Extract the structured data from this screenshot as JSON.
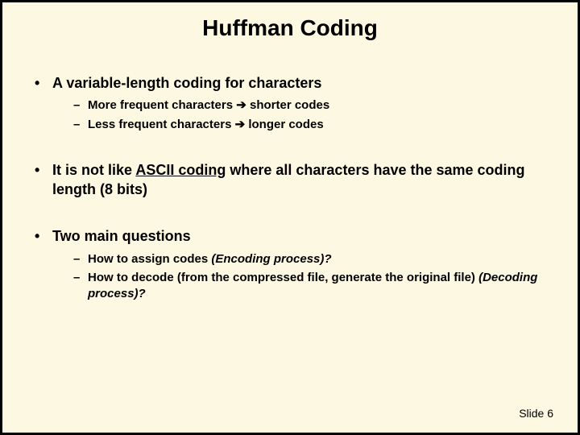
{
  "title": "Huffman Coding",
  "bullets": {
    "b1": {
      "text": "A variable-length coding for characters",
      "sub": {
        "s1a": "More frequent characters ",
        "s1arrow": "➔",
        "s1b": " shorter codes",
        "s2a": "Less frequent characters ",
        "s2arrow": "➔",
        "s2b": " longer codes"
      }
    },
    "b2": {
      "prefix": "It is not like ",
      "underlined": "ASCII coding",
      "suffix": " where all characters have the same coding length (8 bits)"
    },
    "b3": {
      "text": "Two main questions",
      "sub": {
        "s1a": "How to assign codes ",
        "s1i": "(Encoding process)?",
        "s2a": "How to decode (from the compressed file, generate the original file) ",
        "s2i": "(Decoding process)?"
      }
    }
  },
  "footer": "Slide 6"
}
